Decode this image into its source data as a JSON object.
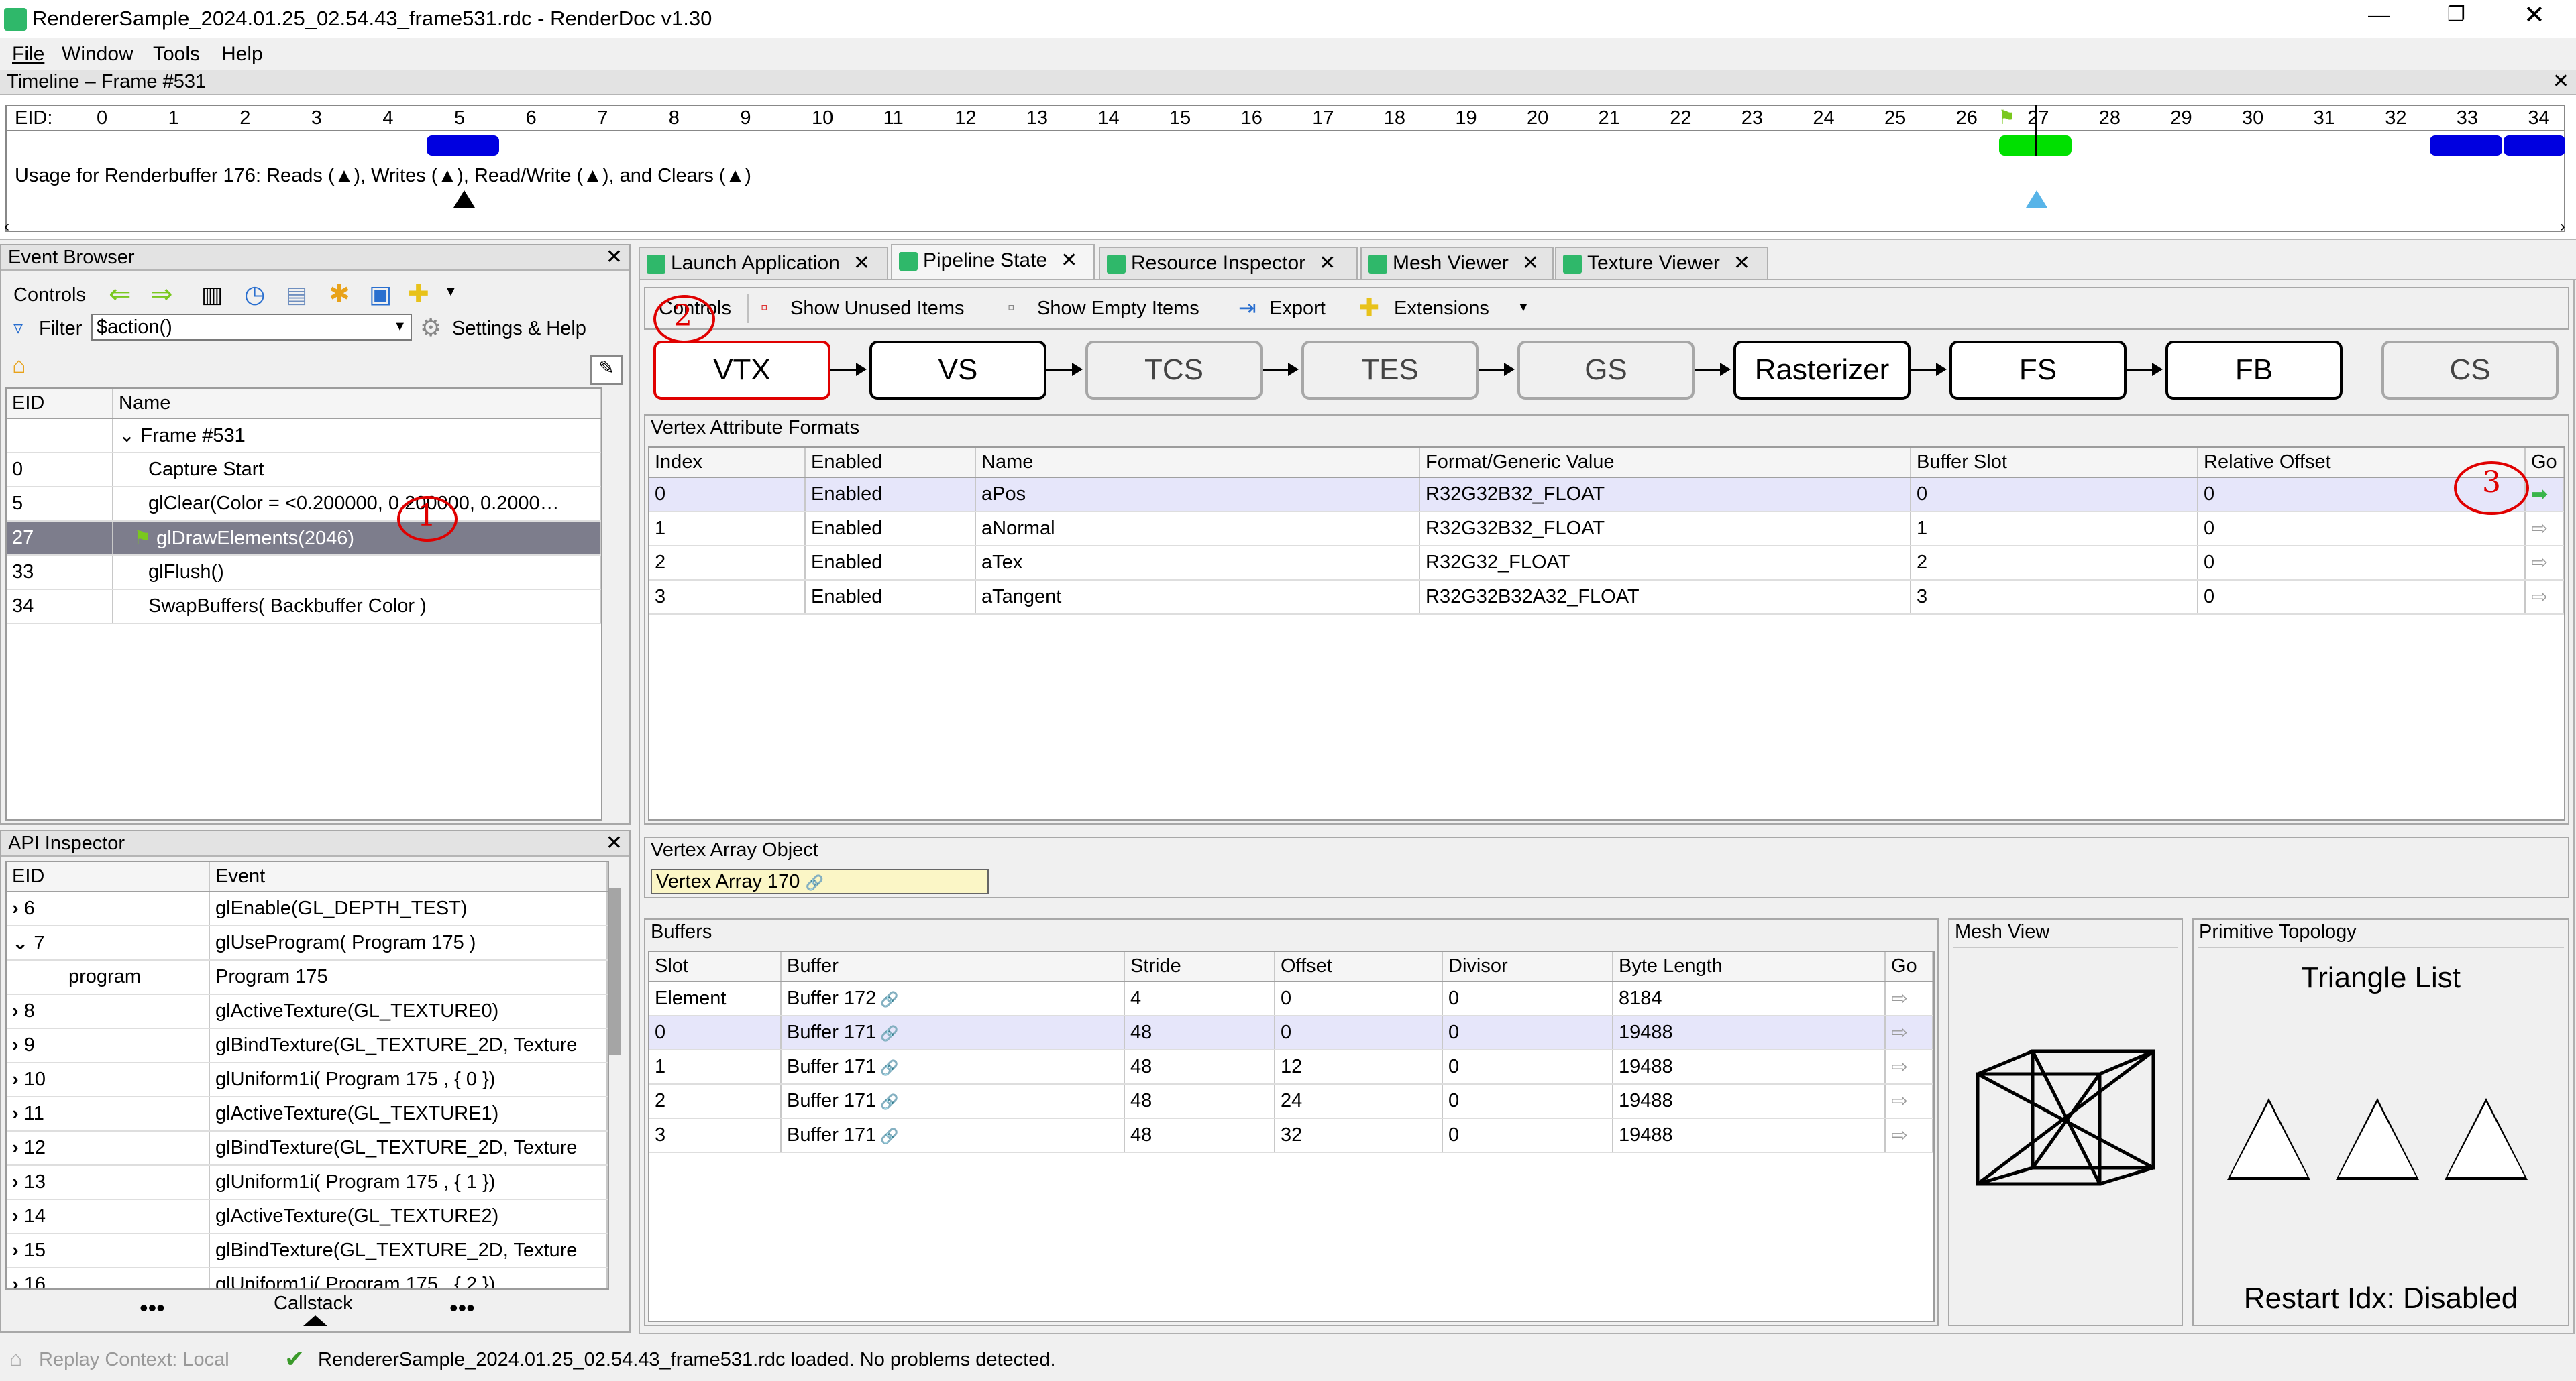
{
  "window": {
    "title": "RendererSample_2024.01.25_02.54.43_frame531.rdc - RenderDoc v1.30"
  },
  "menu": [
    "File",
    "Window",
    "Tools",
    "Help"
  ],
  "timeline": {
    "title": "Timeline – Frame #531",
    "eid_label": "EID:",
    "ticks": [
      "0",
      "1",
      "2",
      "3",
      "4",
      "5",
      "6",
      "7",
      "8",
      "9",
      "10",
      "11",
      "12",
      "13",
      "14",
      "15",
      "16",
      "17",
      "18",
      "19",
      "20",
      "21",
      "22",
      "23",
      "24",
      "25",
      "26",
      "27",
      "28",
      "29",
      "30",
      "31",
      "32",
      "33",
      "34"
    ],
    "usage_text": "Usage for Renderbuffer 176: Reads (▲), Writes (▲), Read/Write (▲), and Clears (▲)"
  },
  "event_browser": {
    "title": "Event Browser",
    "controls_label": "Controls",
    "filter_label": "Filter",
    "filter_value": "$action()",
    "settings_label": "Settings & Help",
    "col_eid": "EID",
    "col_name": "Name",
    "rows": [
      {
        "eid": "",
        "name": "Frame #531"
      },
      {
        "eid": "0",
        "name": "Capture Start"
      },
      {
        "eid": "5",
        "name": "glClear(Color = <0.200000, 0.200000, 0.2000…"
      },
      {
        "eid": "27",
        "name": "glDrawElements(2046)"
      },
      {
        "eid": "33",
        "name": "glFlush()"
      },
      {
        "eid": "34",
        "name": "SwapBuffers( Backbuffer Color )"
      }
    ]
  },
  "api_inspector": {
    "title": "API Inspector",
    "col_eid": "EID",
    "col_event": "Event",
    "rows": [
      {
        "eid": "6",
        "event": "glEnable(GL_DEPTH_TEST)"
      },
      {
        "eid": "7",
        "event": "glUseProgram( Program 175 )"
      },
      {
        "eid": "program",
        "event": "Program 175"
      },
      {
        "eid": "8",
        "event": "glActiveTexture(GL_TEXTURE0)"
      },
      {
        "eid": "9",
        "event": "glBindTexture(GL_TEXTURE_2D,  Texture"
      },
      {
        "eid": "10",
        "event": "glUniform1i( Program 175 , { 0 })"
      },
      {
        "eid": "11",
        "event": "glActiveTexture(GL_TEXTURE1)"
      },
      {
        "eid": "12",
        "event": "glBindTexture(GL_TEXTURE_2D,  Texture"
      },
      {
        "eid": "13",
        "event": "glUniform1i( Program 175 , { 1 })"
      },
      {
        "eid": "14",
        "event": "glActiveTexture(GL_TEXTURE2)"
      },
      {
        "eid": "15",
        "event": "glBindTexture(GL_TEXTURE_2D,  Texture"
      },
      {
        "eid": "16",
        "event": "glUniform1i( Program 175 , { 2 })"
      }
    ],
    "callstack_label": "Callstack"
  },
  "tabs": [
    "Launch Application",
    "Pipeline State",
    "Resource Inspector",
    "Mesh Viewer",
    "Texture Viewer"
  ],
  "pipeline": {
    "controls_label": "Controls",
    "show_unused": "Show Unused Items",
    "show_empty": "Show Empty Items",
    "export": "Export",
    "extensions": "Extensions",
    "stages": [
      "VTX",
      "VS",
      "TCS",
      "TES",
      "GS",
      "Rasterizer",
      "FS",
      "FB",
      "CS"
    ]
  },
  "vertex_attr": {
    "title": "Vertex Attribute Formats",
    "cols": [
      "Index",
      "Enabled",
      "Name",
      "Format/Generic Value",
      "Buffer Slot",
      "Relative Offset",
      "Go"
    ],
    "rows": [
      [
        "0",
        "Enabled",
        "aPos",
        "R32G32B32_FLOAT",
        "0",
        "0"
      ],
      [
        "1",
        "Enabled",
        "aNormal",
        "R32G32B32_FLOAT",
        "1",
        "0"
      ],
      [
        "2",
        "Enabled",
        "aTex",
        "R32G32_FLOAT",
        "2",
        "0"
      ],
      [
        "3",
        "Enabled",
        "aTangent",
        "R32G32B32A32_FLOAT",
        "3",
        "0"
      ]
    ]
  },
  "vao": {
    "title": "Vertex Array Object",
    "value": "Vertex Array 170"
  },
  "buffers": {
    "title": "Buffers",
    "cols": [
      "Slot",
      "Buffer",
      "Stride",
      "Offset",
      "Divisor",
      "Byte Length",
      "Go"
    ],
    "rows": [
      [
        "Element",
        "Buffer 172",
        "4",
        "0",
        "0",
        "8184"
      ],
      [
        "0",
        "Buffer 171",
        "48",
        "0",
        "0",
        "19488"
      ],
      [
        "1",
        "Buffer 171",
        "48",
        "12",
        "0",
        "19488"
      ],
      [
        "2",
        "Buffer 171",
        "48",
        "24",
        "0",
        "19488"
      ],
      [
        "3",
        "Buffer 171",
        "48",
        "32",
        "0",
        "19488"
      ]
    ]
  },
  "mesh_view": {
    "title": "Mesh View"
  },
  "topology": {
    "title": "Primitive Topology",
    "value": "Triangle List",
    "restart": "Restart Idx: Disabled"
  },
  "status": {
    "replay": "Replay Context: Local",
    "message": "RendererSample_2024.01.25_02.54.43_frame531.rdc loaded. No problems detected."
  },
  "annotations": [
    "1",
    "2",
    "3"
  ],
  "colors": {
    "accent": "#2fb86a",
    "selected_row": "#7d7d8c",
    "highlight": "#e6e6fa",
    "marker_blue": "#0000e0",
    "marker_green": "#00e000"
  }
}
